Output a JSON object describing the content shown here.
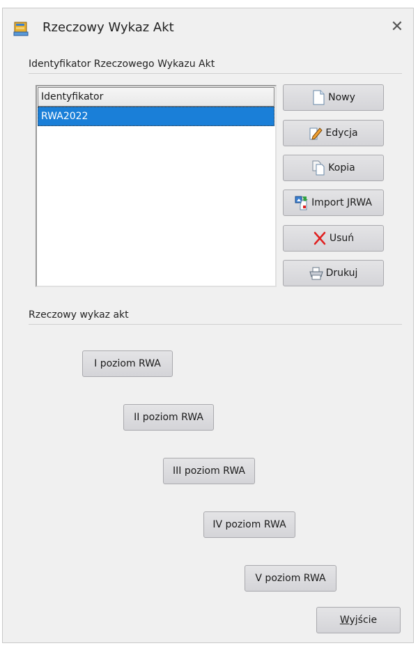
{
  "window": {
    "title": "Rzeczowy Wykaz Akt",
    "close_glyph": "✕"
  },
  "section_identifier": {
    "label": "Identyfikator Rzeczowego Wykazu Akt",
    "list": {
      "header": "Identyfikator",
      "rows": [
        "RWA2022"
      ],
      "selected_index": 0
    },
    "buttons": {
      "new": "Nowy",
      "edit": "Edycja",
      "copy": "Kopia",
      "import": "Import JRWA",
      "delete": "Usuń",
      "print": "Drukuj"
    }
  },
  "section_levels": {
    "label": "Rzeczowy wykaz akt",
    "levels": [
      "I poziom RWA",
      "II poziom RWA",
      "III poziom RWA",
      "IV poziom RWA",
      "V poziom RWA"
    ]
  },
  "exit_button": {
    "underlined_char": "W",
    "rest": "yjście"
  },
  "colors": {
    "selection": "#1a7fd8",
    "window_bg": "#f0f0f0",
    "delete_icon": "#e02020"
  }
}
